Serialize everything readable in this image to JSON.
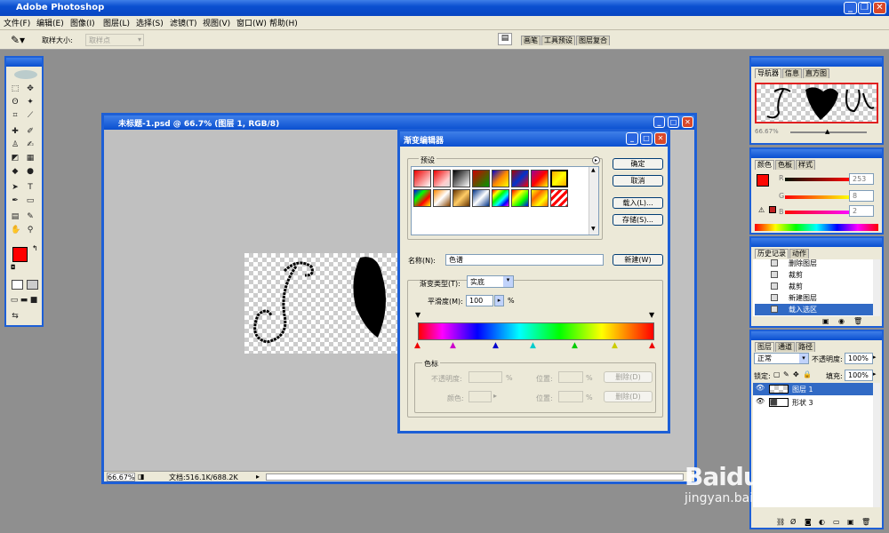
{
  "app": {
    "title": "Adobe Photoshop"
  },
  "menu": [
    "文件(F)",
    "编辑(E)",
    "图像(I)",
    "图层(L)",
    "选择(S)",
    "滤镜(T)",
    "视图(V)",
    "窗口(W)",
    "帮助(H)"
  ],
  "options": {
    "sample_size_label": "取样大小:",
    "sample_size_value": "取样点",
    "palette_tabs": [
      "画笔",
      "工具预设",
      "图层复合"
    ]
  },
  "document": {
    "title": "未标题-1.psd @ 66.7% (图层 1, RGB/8)",
    "zoom": "66.67%",
    "doc_info": "文档:516.1K/688.2K"
  },
  "dialog": {
    "title": "渐变编辑器",
    "presets_label": "预设",
    "buttons": {
      "ok": "确定",
      "cancel": "取消",
      "load": "载入(L)...",
      "save": "存储(S)...",
      "new": "新建(W)"
    },
    "name_label": "名称(N):",
    "name_value": "色谱",
    "type_label": "渐变类型(T):",
    "type_value": "实底",
    "smooth_label": "平滑度(M):",
    "smooth_value": "100",
    "percent": "%",
    "stops_group": "色标",
    "opacity_label": "不透明度:",
    "color_label": "颜色:",
    "location_label": "位置:",
    "delete_label": "删除(D)"
  },
  "navigator": {
    "tabs": [
      "导航器",
      "信息",
      "直方图"
    ],
    "zoom": "66.67%"
  },
  "color": {
    "tabs": [
      "颜色",
      "色板",
      "样式"
    ],
    "channels": [
      {
        "label": "R",
        "value": "253"
      },
      {
        "label": "G",
        "value": "8"
      },
      {
        "label": "B",
        "value": "2"
      }
    ],
    "fg": "#fd0802"
  },
  "history": {
    "tabs": [
      "历史记录",
      "动作"
    ],
    "items": [
      "删除图层",
      "裁剪",
      "裁剪",
      "新建图层",
      "载入选区"
    ]
  },
  "layers": {
    "tabs": [
      "图层",
      "通道",
      "路径"
    ],
    "blend_mode": "正常",
    "opacity_label": "不透明度:",
    "opacity_value": "100%",
    "lock_label": "锁定:",
    "fill_label": "填充:",
    "fill_value": "100%",
    "items": [
      "图层 1",
      "形状 3"
    ]
  },
  "watermark": {
    "text": "Baidu经验",
    "url": "jingyan.baidu.com"
  }
}
